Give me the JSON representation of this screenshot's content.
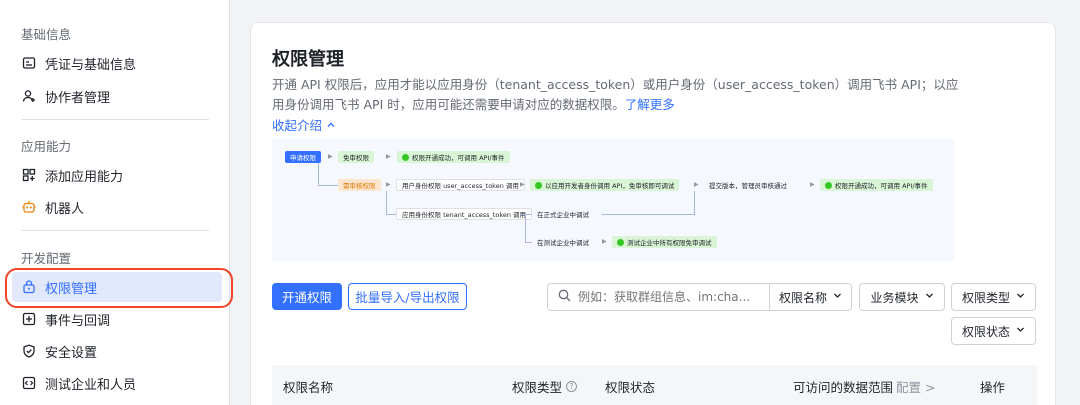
{
  "sidebar": {
    "sections": [
      {
        "title": "基础信息",
        "items": [
          {
            "label": "凭证与基础信息",
            "icon": "credential-icon"
          },
          {
            "label": "协作者管理",
            "icon": "user-add-icon"
          }
        ]
      },
      {
        "title": "应用能力",
        "items": [
          {
            "label": "添加应用能力",
            "icon": "grid-add-icon"
          },
          {
            "label": "机器人",
            "icon": "robot-icon"
          }
        ]
      },
      {
        "title": "开发配置",
        "items": [
          {
            "label": "权限管理",
            "icon": "lock-icon"
          },
          {
            "label": "事件与回调",
            "icon": "event-icon"
          },
          {
            "label": "安全设置",
            "icon": "shield-icon"
          },
          {
            "label": "测试企业和人员",
            "icon": "code-icon"
          }
        ]
      }
    ],
    "active_item": "权限管理"
  },
  "main": {
    "title": "权限管理",
    "description": "开通 API 权限后，应用才能以应用身份（tenant_access_token）或用户身份（user_access_token）调用飞书 API；以应用身份调用飞书 API 时，应用可能还需要申请对应的数据权限。",
    "learn_more": "了解更多",
    "collapse_label": "收起介绍",
    "flow": {
      "apply": "申请权限",
      "no_review": "免审权限",
      "no_review_result": "权限开通成功，可调用 API/事件",
      "need_review": "需审核权限",
      "user_token": "用户身份权限 user_access_token 调用",
      "dev_debug": "以应用开发者身份调用 API，免审核即可调试",
      "submit": "提交版本，管理员审核通过",
      "final": "权限开通成功，可调用 API/事件",
      "app_token": "应用身份权限 tenant_access_token 调用",
      "formal_debug": "在正式企业中调试",
      "test_debug": "在测试企业中调试",
      "test_result": "测试企业中所有权限免审调试"
    },
    "toolbar": {
      "enable_button": "开通权限",
      "batch_button": "批量导入/导出权限",
      "search_placeholder": "例如：获取群组信息、im:cha...",
      "search_field": "权限名称",
      "filter_module": "业务模块",
      "filter_type": "权限类型",
      "filter_status": "权限状态"
    },
    "table": {
      "col_name": "权限名称",
      "col_type": "权限类型",
      "col_status": "权限状态",
      "col_scope": "可访问的数据范围",
      "col_scope_config": "配置 >",
      "col_action": "操作"
    }
  },
  "colors": {
    "accent": "#3370ff",
    "highlight_ring": "#f0442b",
    "active_bg": "#e1e8fb"
  }
}
